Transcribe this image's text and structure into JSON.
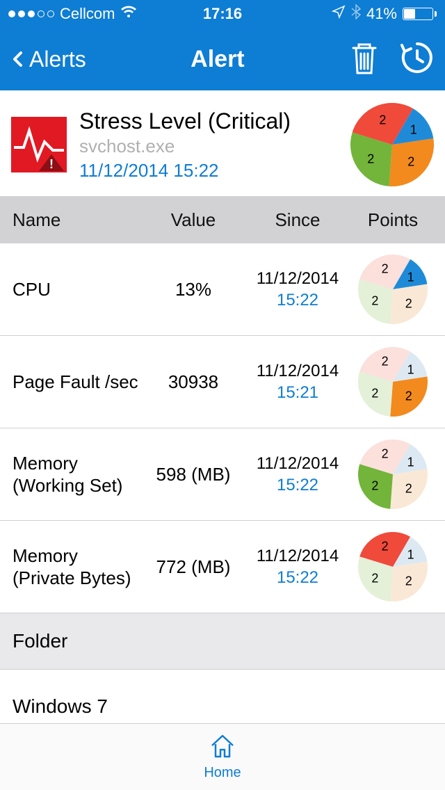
{
  "status": {
    "carrier": "Cellcom",
    "time": "17:16",
    "battery_pct": "41%",
    "battery_fill_pct": 41
  },
  "nav": {
    "back_label": "Alerts",
    "title": "Alert"
  },
  "summary": {
    "title": "Stress Level (Critical)",
    "process": "svchost.exe",
    "timestamp": "11/12/2014 15:22"
  },
  "columns": {
    "name": "Name",
    "value": "Value",
    "since": "Since",
    "points": "Points"
  },
  "rows": [
    {
      "name": "CPU",
      "value": "13%",
      "date": "11/12/2014",
      "time": "15:22",
      "active_slice": 0
    },
    {
      "name": "Page Fault /sec",
      "value": "30938",
      "date": "11/12/2014",
      "time": "15:21",
      "active_slice": 1
    },
    {
      "name": "Memory (Working Set)",
      "value": "598 (MB)",
      "date": "11/12/2014",
      "time": "15:22",
      "active_slice": 2
    },
    {
      "name": "Memory (Private Bytes)",
      "value": "772 (MB)",
      "date": "11/12/2014",
      "time": "15:22",
      "active_slice": 3
    }
  ],
  "section": {
    "label": "Folder"
  },
  "folder": {
    "name": "Windows 7"
  },
  "tab": {
    "home": "Home"
  },
  "colors": {
    "brand": "#0e7dd4",
    "blue": "#1f8bd8",
    "orange": "#f28a1e",
    "green": "#73b43a",
    "red": "#ef4a3a",
    "dim_blue": "#dce9f2",
    "dim_orange": "#fae8d6",
    "dim_green": "#e4f0d8",
    "dim_red": "#fbe0dc"
  },
  "chart_data": [
    {
      "type": "pie",
      "title": "Summary points",
      "series": [
        {
          "name": "CPU",
          "value": 1,
          "label": "1",
          "color": "#1f8bd8"
        },
        {
          "name": "Page Fault /sec",
          "value": 2,
          "label": "2",
          "color": "#f28a1e"
        },
        {
          "name": "Memory (Working Set)",
          "value": 2,
          "label": "2",
          "color": "#73b43a"
        },
        {
          "name": "Memory (Private Bytes)",
          "value": 2,
          "label": "2",
          "color": "#ef4a3a"
        }
      ]
    },
    {
      "type": "pie",
      "title": "CPU points",
      "active_index": 0,
      "series": [
        {
          "name": "CPU",
          "value": 1,
          "label": "1"
        },
        {
          "name": "Page Fault /sec",
          "value": 2,
          "label": "2"
        },
        {
          "name": "Memory (Working Set)",
          "value": 2,
          "label": "2"
        },
        {
          "name": "Memory (Private Bytes)",
          "value": 2,
          "label": "2"
        }
      ]
    },
    {
      "type": "pie",
      "title": "Page Fault points",
      "active_index": 1,
      "series": [
        {
          "name": "CPU",
          "value": 1,
          "label": "1"
        },
        {
          "name": "Page Fault /sec",
          "value": 2,
          "label": "2"
        },
        {
          "name": "Memory (Working Set)",
          "value": 2,
          "label": "2"
        },
        {
          "name": "Memory (Private Bytes)",
          "value": 2,
          "label": "2"
        }
      ]
    },
    {
      "type": "pie",
      "title": "Memory WS points",
      "active_index": 2,
      "series": [
        {
          "name": "CPU",
          "value": 1,
          "label": "1"
        },
        {
          "name": "Page Fault /sec",
          "value": 2,
          "label": "2"
        },
        {
          "name": "Memory (Working Set)",
          "value": 2,
          "label": "2"
        },
        {
          "name": "Memory (Private Bytes)",
          "value": 2,
          "label": "2"
        }
      ]
    },
    {
      "type": "pie",
      "title": "Memory PB points",
      "active_index": 3,
      "series": [
        {
          "name": "CPU",
          "value": 1,
          "label": "1"
        },
        {
          "name": "Page Fault /sec",
          "value": 2,
          "label": "2"
        },
        {
          "name": "Memory (Working Set)",
          "value": 2,
          "label": "2"
        },
        {
          "name": "Memory (Private Bytes)",
          "value": 2,
          "label": "2"
        }
      ]
    }
  ]
}
